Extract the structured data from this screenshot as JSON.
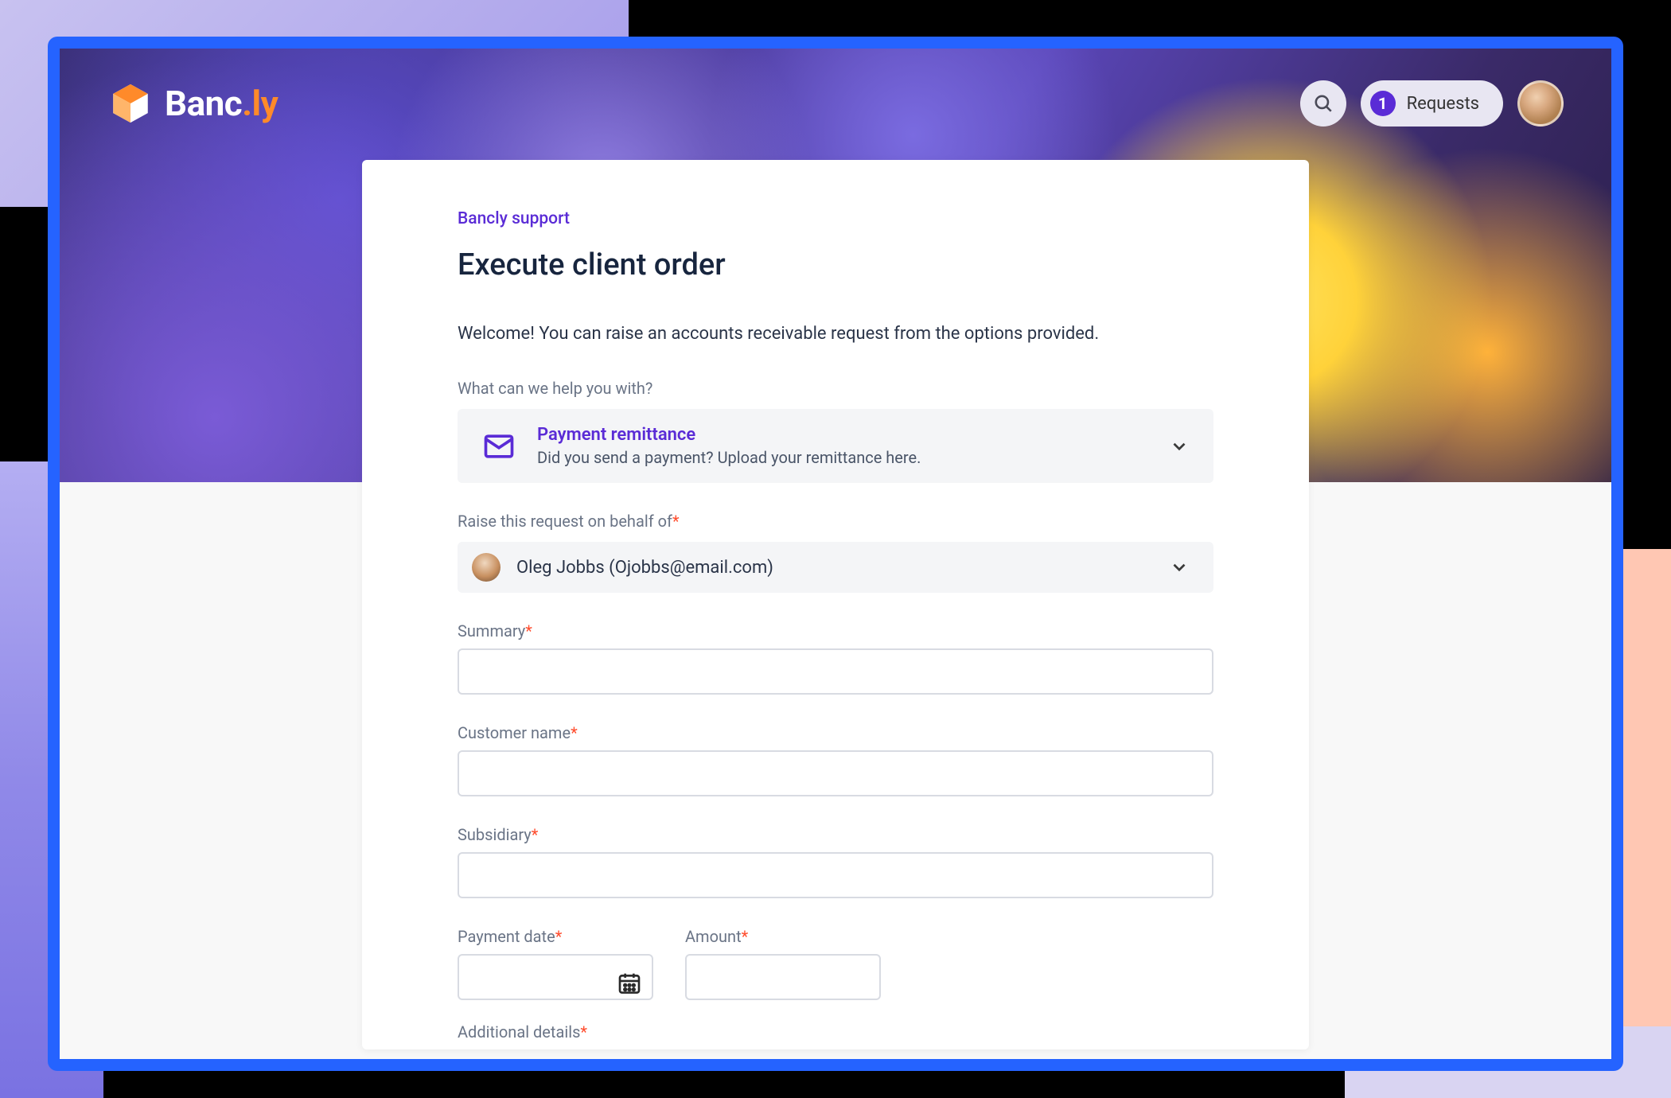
{
  "brand": {
    "name_a": "Banc",
    "name_b": ".ly"
  },
  "header": {
    "requests_count": "1",
    "requests_label": "Requests"
  },
  "breadcrumb": "Bancly support",
  "page_title": "Execute client order",
  "welcome": "Welcome! You can raise an accounts receivable request from the options provided.",
  "help_label": "What can we help you with?",
  "option": {
    "title": "Payment remittance",
    "desc": "Did you send a payment? Upload your remittance here."
  },
  "behalf_label": "Raise this request on behalf of",
  "user": {
    "display": "Oleg Jobbs (Ojobbs@email.com)"
  },
  "fields": {
    "summary": "Summary",
    "customer_name": "Customer name",
    "subsidiary": "Subsidiary",
    "payment_date": "Payment date",
    "amount": "Amount",
    "additional_details": "Additional details"
  },
  "required_marker": "*"
}
